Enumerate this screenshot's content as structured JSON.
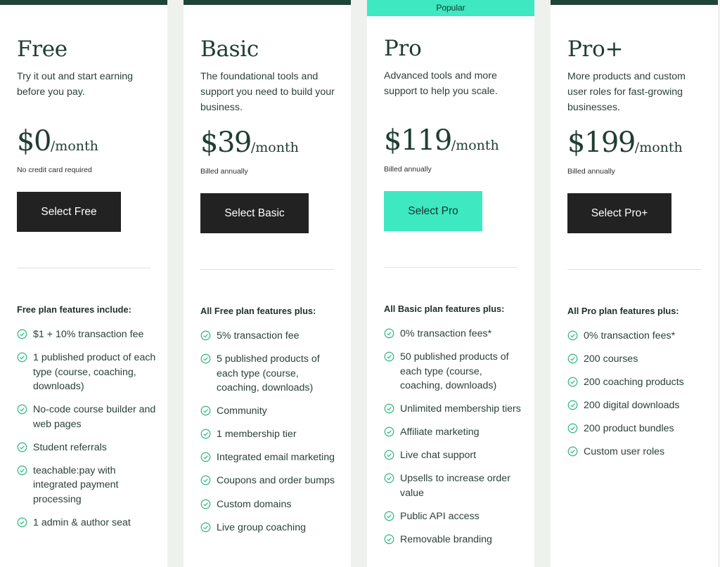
{
  "plans": [
    {
      "name": "Free",
      "description": "Try it out and start earning before you pay.",
      "price": "$0",
      "period": "/month",
      "note": "No credit card required",
      "button": "Select Free",
      "features_heading": "Free plan features include:",
      "features": [
        "$1 + 10% transaction fee",
        "1 published product of each type (course, coaching, downloads)",
        "No-code course builder and web pages",
        "Student referrals",
        "teachable:pay with integrated payment processing",
        "1 admin & author seat"
      ]
    },
    {
      "name": "Basic",
      "description": "The foundational tools and support you need to build your business.",
      "price": "$39",
      "period": "/month",
      "note": "Billed annually",
      "button": "Select Basic",
      "features_heading": "All Free plan features plus:",
      "features": [
        "5% transaction fee",
        "5 published products of each type (course, coaching, downloads)",
        "Community",
        "1 membership tier",
        "Integrated email marketing",
        "Coupons and order bumps",
        "Custom domains",
        "Live group coaching"
      ]
    },
    {
      "badge": "Popular",
      "name": "Pro",
      "description": "Advanced tools and more support to help you scale.",
      "price": "$119",
      "period": "/month",
      "note": "Billed annually",
      "button": "Select Pro",
      "features_heading": "All Basic plan features plus:",
      "features": [
        "0% transaction fees*",
        "50 published products of each type (course, coaching, downloads)",
        "Unlimited membership tiers",
        "Affiliate marketing",
        "Live chat support",
        "Upsells to increase order value",
        "Public API access",
        "Removable branding"
      ]
    },
    {
      "name": "Pro+",
      "description": "More products and custom user roles for fast-growing businesses.",
      "price": "$199",
      "period": "/month",
      "note": "Billed annually",
      "button": "Select Pro+",
      "features_heading": "All Pro plan features plus:",
      "features": [
        "0% transaction fees*",
        "200 courses",
        "200 coaching products",
        "200 digital downloads",
        "200 product bundles",
        "Custom user roles"
      ]
    }
  ],
  "colors": {
    "accent_mint": "#3ee8c1",
    "dark_green": "#1f4538",
    "button_dark": "#222222",
    "check_green": "#2fb77f"
  }
}
